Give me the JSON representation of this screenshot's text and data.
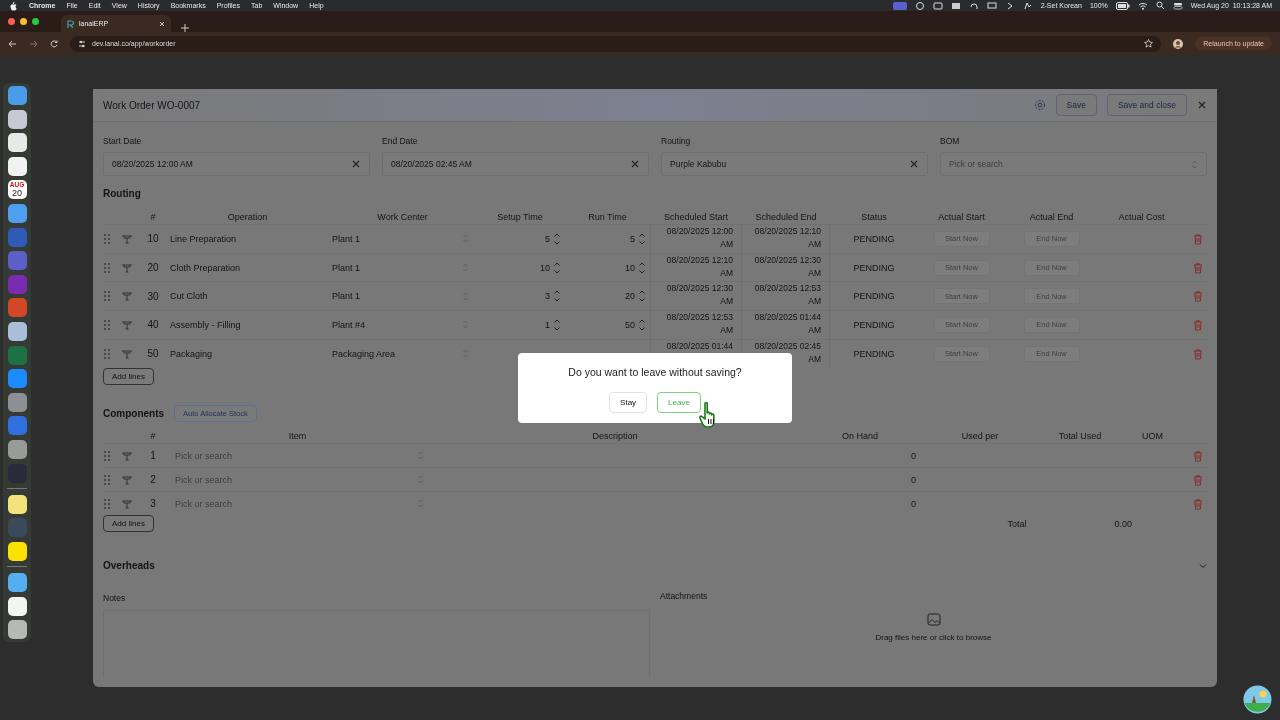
{
  "menubar": {
    "app": "Chrome",
    "menus": [
      "File",
      "Edit",
      "View",
      "History",
      "Bookmarks",
      "Profiles",
      "Tab",
      "Window",
      "Help"
    ],
    "input_source": "2-Set Korean",
    "battery": "100%",
    "clock": "Wed Aug 20  10:13:28 AM"
  },
  "browser": {
    "tab": {
      "title": "lanaiERP"
    },
    "url": "dev.lanai.co/app/workorder",
    "update_button": "Relaunch to update"
  },
  "dock": {
    "items": [
      {
        "kind": "app",
        "color": "#4a9be8"
      },
      {
        "kind": "app",
        "color": "#c9c9d6"
      },
      {
        "kind": "app",
        "color": "#e8e8e8"
      },
      {
        "kind": "app",
        "color": "#f2f2f2"
      },
      {
        "kind": "calendar",
        "color": "#ffffff",
        "month": "AUG",
        "day": "20"
      },
      {
        "kind": "app",
        "color": "#4f9ff0"
      },
      {
        "kind": "app",
        "color": "#2f5bb7"
      },
      {
        "kind": "app",
        "color": "#5b5fc7"
      },
      {
        "kind": "app",
        "color": "#7a2bb0"
      },
      {
        "kind": "app",
        "color": "#d24726"
      },
      {
        "kind": "app",
        "color": "#a9bfd8"
      },
      {
        "kind": "app",
        "color": "#1e7145"
      },
      {
        "kind": "app",
        "color": "#1a8cff"
      },
      {
        "kind": "app",
        "color": "#8e8e93"
      },
      {
        "kind": "app",
        "color": "#2f6fe0"
      },
      {
        "kind": "app",
        "color": "#9a9a9a"
      },
      {
        "kind": "app",
        "color": "#2a2a3a"
      },
      {
        "kind": "separator"
      },
      {
        "kind": "app",
        "color": "#f5e27a"
      },
      {
        "kind": "app",
        "color": "#3b4a5a"
      },
      {
        "kind": "app",
        "color": "#fae100"
      },
      {
        "kind": "separator"
      },
      {
        "kind": "app",
        "color": "#55aef0"
      },
      {
        "kind": "app",
        "color": "#f4f4f4"
      },
      {
        "kind": "app",
        "color": "#b8b8b8"
      }
    ]
  },
  "work_order": {
    "title": "Work Order WO-0007",
    "buttons": [
      "Save",
      "Save and close"
    ],
    "fields": [
      {
        "label": "Start Date",
        "value": "08/20/2025 12:00 AM",
        "kind": "clearable"
      },
      {
        "label": "End Date",
        "value": "08/20/2025 02:45 AM",
        "kind": "clearable"
      },
      {
        "label": "Routing",
        "value": "Purple Kabubu",
        "kind": "clearable"
      },
      {
        "label": "BOM",
        "placeholder": "Pick or search",
        "kind": "select"
      }
    ],
    "routing": {
      "heading": "Routing",
      "columns": [
        "#",
        "Operation",
        "Work Center",
        "Setup Time",
        "Run Time",
        "Scheduled Start",
        "Scheduled End",
        "Status",
        "Actual Start",
        "Actual End",
        "Actual Cost"
      ],
      "rows": [
        {
          "seq": "10",
          "operation": "Line Preparation",
          "work_center": "Plant 1",
          "setup_time": "5",
          "run_time": "5",
          "scheduled_start": "08/20/2025 12:00 AM",
          "scheduled_end": "08/20/2025 12:10 AM",
          "status": "PENDING",
          "actual_start_placeholder": "Start Now",
          "actual_end_placeholder": "End Now"
        },
        {
          "seq": "20",
          "operation": "Cloth Preparation",
          "work_center": "Plant 1",
          "setup_time": "10",
          "run_time": "10",
          "scheduled_start": "08/20/2025 12:10 AM",
          "scheduled_end": "08/20/2025 12:30 AM",
          "status": "PENDING",
          "actual_start_placeholder": "Start Now",
          "actual_end_placeholder": "End Now"
        },
        {
          "seq": "30",
          "operation": "Cut Cloth",
          "work_center": "Plant 1",
          "setup_time": "3",
          "run_time": "20",
          "scheduled_start": "08/20/2025 12:30 AM",
          "scheduled_end": "08/20/2025 12:53 AM",
          "status": "PENDING",
          "actual_start_placeholder": "Start Now",
          "actual_end_placeholder": "End Now"
        },
        {
          "seq": "40",
          "operation": "Assembly - Filling",
          "work_center": "Plant #4",
          "setup_time": "1",
          "run_time": "50",
          "scheduled_start": "08/20/2025 12:53 AM",
          "scheduled_end": "08/20/2025 01:44 AM",
          "status": "PENDING",
          "actual_start_placeholder": "Start Now",
          "actual_end_placeholder": "End Now"
        },
        {
          "seq": "50",
          "operation": "Packaging",
          "work_center": "Packaging Area",
          "scheduled_start": "08/20/2025 01:44",
          "scheduled_end": "08/20/2025 02:45 AM",
          "status": "PENDING",
          "actual_start_placeholder": "Start Now",
          "actual_end_placeholder": "End Now"
        }
      ],
      "add_button": "Add lines"
    },
    "components": {
      "heading": "Components",
      "allocate_button": "Auto Allocate Stock",
      "columns": [
        "#",
        "Item",
        "Description",
        "On Hand",
        "Used per",
        "Total Used",
        "UOM"
      ],
      "rows": [
        {
          "seq": "1",
          "item_placeholder": "Pick or search",
          "on_hand": "0"
        },
        {
          "seq": "2",
          "item_placeholder": "Pick or search",
          "on_hand": "0"
        },
        {
          "seq": "3",
          "item_placeholder": "Pick or search",
          "on_hand": "0"
        }
      ],
      "add_button": "Add lines",
      "total_label": "Total",
      "total_value": "0.00"
    },
    "overheads": {
      "heading": "Overheads",
      "expanded": false
    },
    "notes": {
      "label": "Notes"
    },
    "attachments": {
      "label": "Attachments",
      "hint": "Drag files here or click to browse"
    }
  },
  "dialog": {
    "message": "Do you want to leave without saving?",
    "buttons": [
      {
        "label": "Stay",
        "kind": "secondary"
      },
      {
        "label": "Leave",
        "kind": "primary"
      }
    ]
  }
}
